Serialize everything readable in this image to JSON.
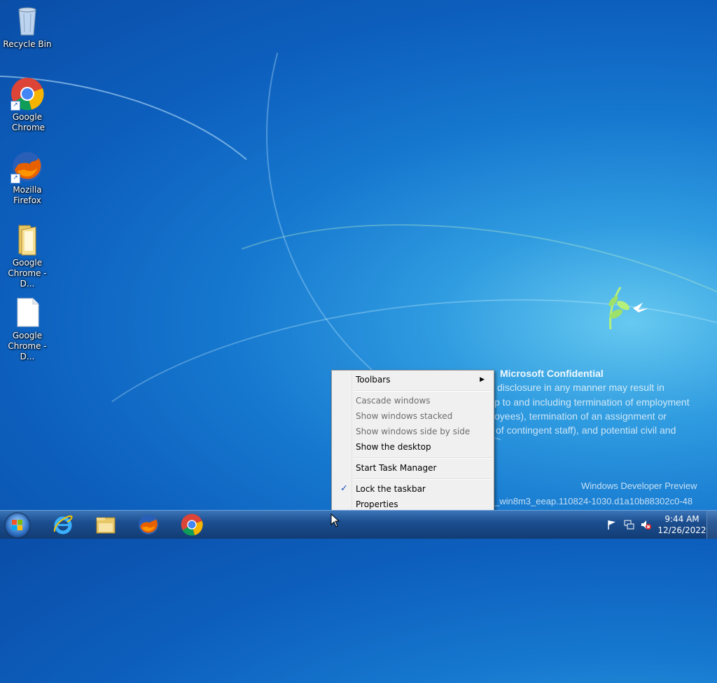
{
  "desktop": {
    "icons": [
      {
        "label": "Recycle Bin",
        "icon": "recycle-bin-icon"
      },
      {
        "label": "Google Chrome",
        "icon": "chrome-icon"
      },
      {
        "label": "Mozilla Firefox",
        "icon": "firefox-icon"
      },
      {
        "label": "Google Chrome - D...",
        "icon": "folder-icon"
      },
      {
        "label": "Google Chrome - D...",
        "icon": "file-icon"
      }
    ]
  },
  "watermark": {
    "title": "Microsoft Confidential",
    "lines": [
      "disclosure in any manner may result in",
      "p to and including termination of employment",
      "oyees), termination of an assignment or",
      "of contingent staff), and potential civil and"
    ],
    "build_title": "Windows Developer Preview",
    "build": "_win8m3_eeap.110824-1030.d1a10b88302c0-48"
  },
  "context_menu": {
    "toolbars": "Toolbars",
    "cascade": "Cascade windows",
    "stacked": "Show windows stacked",
    "side_by_side": "Show windows side by side",
    "show_desktop": "Show the desktop",
    "task_manager": "Start Task Manager",
    "lock_taskbar": "Lock the taskbar",
    "properties": "Properties",
    "lock_checked": true
  },
  "taskbar": {
    "pinned": [
      "internet-explorer-icon",
      "file-explorer-icon",
      "firefox-icon",
      "chrome-icon"
    ],
    "tray_icons": [
      "action-center-flag-icon",
      "network-icon",
      "volume-muted-icon"
    ],
    "time": "9:44 AM",
    "date": "12/26/2022"
  },
  "colors": {
    "taskbar": "#1c4f90",
    "menu_bg": "#f0f0f0",
    "accent": "#1a4fbb"
  }
}
